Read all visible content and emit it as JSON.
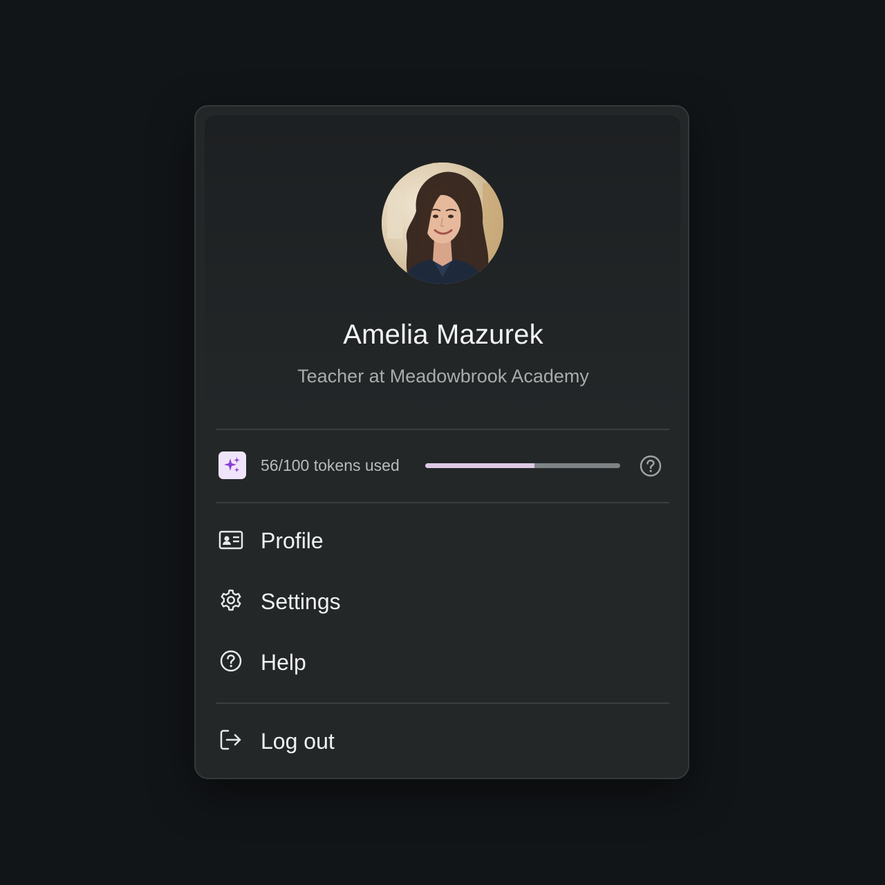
{
  "user": {
    "name": "Amelia Mazurek",
    "role": "Teacher at Meadowbrook Academy"
  },
  "tokens": {
    "label": "56/100 tokens used",
    "used": 56,
    "total": 100
  },
  "menu_items": [
    {
      "label": "Profile",
      "icon": "id-card-icon"
    },
    {
      "label": "Settings",
      "icon": "gear-icon"
    },
    {
      "label": "Help",
      "icon": "help-circle-icon"
    },
    {
      "label": "Log out",
      "icon": "logout-icon"
    }
  ],
  "colors": {
    "page_background": "#121518",
    "menu_background": "#232728",
    "progress_fill": "#ddc9e6",
    "progress_track": "#7e8386",
    "sparkle_badge": "#f0e4fb",
    "sparkle_accent": "#8a3fd1"
  }
}
